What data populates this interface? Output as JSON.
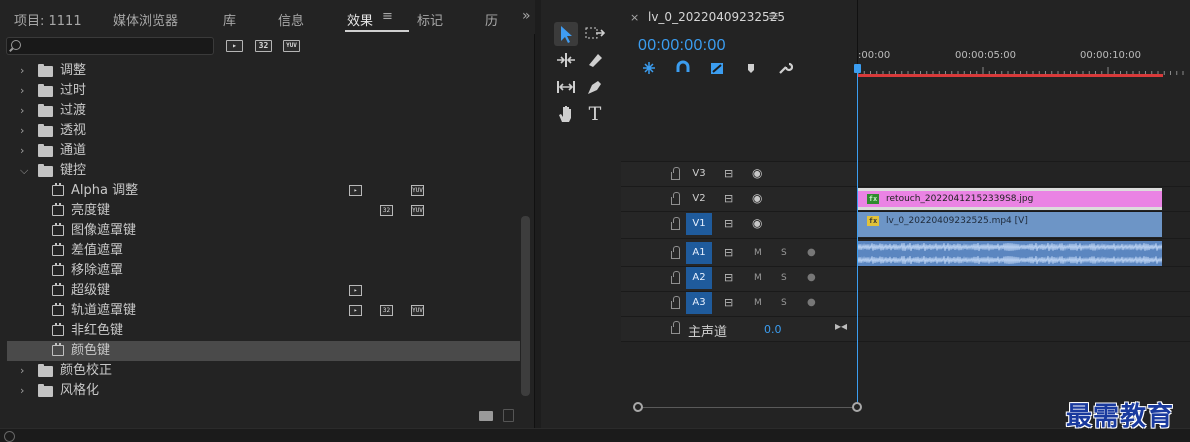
{
  "left_panel": {
    "tabs": [
      {
        "label": "项目: 1111"
      },
      {
        "label": "媒体浏览器"
      },
      {
        "label": "库"
      },
      {
        "label": "信息"
      },
      {
        "label": "效果"
      },
      {
        "label": "标记"
      },
      {
        "label": "历"
      }
    ],
    "active_tab": "效果",
    "menu_glyph": "≡",
    "overflow_glyph": "»",
    "search": {
      "value": "",
      "placeholder": ""
    },
    "accel_badges": [
      "32",
      "YUV"
    ],
    "tree": [
      {
        "type": "folder",
        "label": "调整",
        "expanded": false
      },
      {
        "type": "folder",
        "label": "过时",
        "expanded": false
      },
      {
        "type": "folder",
        "label": "过渡",
        "expanded": false
      },
      {
        "type": "folder",
        "label": "透视",
        "expanded": false
      },
      {
        "type": "folder",
        "label": "通道",
        "expanded": false
      },
      {
        "type": "folder",
        "label": "键控",
        "expanded": true
      },
      {
        "type": "effect",
        "label": "Alpha 调整",
        "accel": true,
        "b32": false,
        "yuv": true
      },
      {
        "type": "effect",
        "label": "亮度键",
        "accel": false,
        "b32": true,
        "yuv": true
      },
      {
        "type": "effect",
        "label": "图像遮罩键",
        "accel": false,
        "b32": false,
        "yuv": false
      },
      {
        "type": "effect",
        "label": "差值遮罩",
        "accel": false,
        "b32": false,
        "yuv": false
      },
      {
        "type": "effect",
        "label": "移除遮罩",
        "accel": false,
        "b32": false,
        "yuv": false
      },
      {
        "type": "effect",
        "label": "超级键",
        "accel": true,
        "b32": false,
        "yuv": false
      },
      {
        "type": "effect",
        "label": "轨道遮罩键",
        "accel": true,
        "b32": true,
        "yuv": true
      },
      {
        "type": "effect",
        "label": "非红色键",
        "accel": false,
        "b32": false,
        "yuv": false
      },
      {
        "type": "effect",
        "label": "颜色键",
        "accel": false,
        "b32": false,
        "yuv": false,
        "selected": true
      },
      {
        "type": "folder",
        "label": "颜色校正",
        "expanded": false
      },
      {
        "type": "folder",
        "label": "风格化",
        "expanded": false
      }
    ]
  },
  "timeline": {
    "close_glyph": "×",
    "sequence_name": "lv_0_20220409232525",
    "menu_glyph": "≡",
    "timecode": "00:00:00:00",
    "ruler_labels": [
      ":00:00",
      "00:00:05:00",
      "00:00:10:00"
    ],
    "video_tracks": [
      {
        "name": "V3",
        "targeted": false
      },
      {
        "name": "V2",
        "targeted": false
      },
      {
        "name": "V1",
        "targeted": true
      }
    ],
    "audio_tracks": [
      {
        "name": "A1",
        "m": "M",
        "s": "S"
      },
      {
        "name": "A2",
        "m": "M",
        "s": "S"
      },
      {
        "name": "A3",
        "m": "M",
        "s": "S"
      }
    ],
    "master": {
      "label": "主声道",
      "value": "0.0"
    },
    "clips": {
      "v2": "retouch_20220412152339S8.jpg",
      "v1": "lv_0_20220409232525.mp4 [V]"
    },
    "fx_badge": "fx"
  },
  "watermark": "最需教育",
  "colors": {
    "accent": "#3b9df0",
    "pink_clip": "#ea83e4",
    "video_clip": "#6d95c6",
    "audio_clip": "#5b86c0",
    "workarea": "#d83a3a",
    "watermark": "#1a3a9e"
  },
  "icons": {
    "tools": [
      "selection-tool",
      "track-select-tool",
      "ripple-edit-tool",
      "razor-tool",
      "slip-tool",
      "pen-tool",
      "hand-tool",
      "type-tool"
    ],
    "timeline_controls": [
      "snap-icon",
      "linked-selection-icon",
      "add-marker-icon",
      "marker-icon",
      "wrench-icon"
    ]
  }
}
